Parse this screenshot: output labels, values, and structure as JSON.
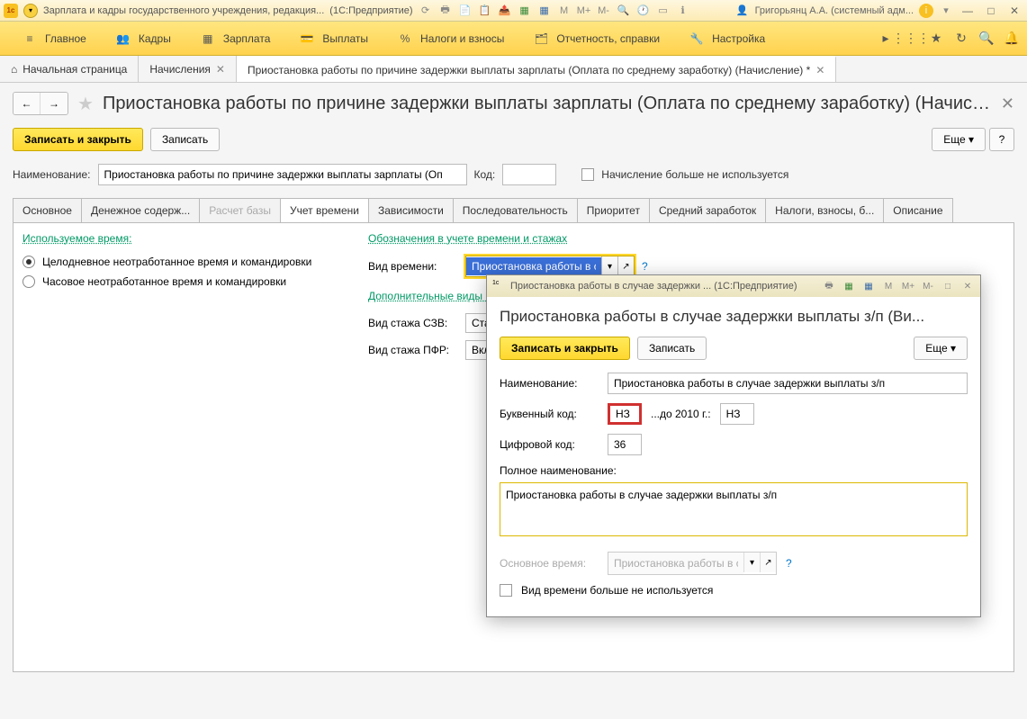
{
  "titlebar": {
    "app_title": "Зарплата и кадры государственного учреждения, редакция...",
    "platform": "(1С:Предприятие)",
    "user": "Григорьянц А.А. (системный адм...",
    "letters": [
      "M",
      "M+",
      "M-"
    ]
  },
  "menu": {
    "items": [
      {
        "label": "Главное",
        "icon": "≡"
      },
      {
        "label": "Кадры",
        "icon": "👥"
      },
      {
        "label": "Зарплата",
        "icon": "▦"
      },
      {
        "label": "Выплаты",
        "icon": "💳"
      },
      {
        "label": "Налоги и взносы",
        "icon": "%"
      },
      {
        "label": "Отчетность, справки",
        "icon": "🗂"
      },
      {
        "label": "Настройка",
        "icon": "🔧"
      }
    ]
  },
  "tabs": {
    "items": [
      {
        "label": "Начальная страница",
        "icon": "⌂",
        "closable": false
      },
      {
        "label": "Начисления",
        "closable": true
      },
      {
        "label": "Приостановка работы по причине задержки выплаты зарплаты (Оплата по среднему заработку) (Начисление) *",
        "closable": true,
        "active": true
      }
    ]
  },
  "page": {
    "title": "Приостановка работы по причине задержки выплаты зарплаты (Оплата по среднему заработку) (Начислени..."
  },
  "toolbar": {
    "save_close": "Записать и закрыть",
    "save": "Записать",
    "more": "Еще",
    "help": "?"
  },
  "form": {
    "name_label": "Наименование:",
    "name_value": "Приостановка работы по причине задержки выплаты зарплаты (Оп",
    "code_label": "Код:",
    "code_value": "",
    "not_used_label": "Начисление больше не используется"
  },
  "inner_tabs": [
    "Основное",
    "Денежное содерж...",
    "Расчет базы",
    "Учет времени",
    "Зависимости",
    "Последовательность",
    "Приоритет",
    "Средний заработок",
    "Налоги, взносы, б...",
    "Описание"
  ],
  "inner_tabs_active": 3,
  "inner_tabs_disabled": [
    2
  ],
  "time_tab": {
    "used_time_title": "Используемое время:",
    "radio1": "Целодневное неотработанное время и командировки",
    "radio2": "Часовое неотработанное время и командировки",
    "designations_title": "Обозначения в учете времени и стажах",
    "time_type_label": "Вид времени:",
    "time_type_value": "Приостановка работы в сл",
    "additional_title": "Дополнительные виды вр",
    "szv_label": "Вид стажа СЗВ:",
    "szv_value": "Стаж д",
    "pfr_label": "Вид стажа ПФР:",
    "pfr_value": "Включ"
  },
  "modal": {
    "window_title": "Приостановка работы в случае задержки ...  (1С:Предприятие)",
    "title": "Приостановка работы в случае задержки выплаты з/п (Ви...",
    "save_close": "Записать и закрыть",
    "save": "Записать",
    "more": "Еще",
    "name_label": "Наименование:",
    "name_value": "Приостановка работы в случае задержки выплаты з/п",
    "letter_code_label": "Буквенный код:",
    "letter_code_value": "НЗ",
    "until_2010_label": "...до 2010 г.:",
    "until_2010_value": "НЗ",
    "digit_code_label": "Цифровой код:",
    "digit_code_value": "36",
    "full_name_label": "Полное наименование:",
    "full_name_value": "Приостановка работы в случае задержки выплаты з/п",
    "main_time_label": "Основное время:",
    "main_time_value": "Приостановка работы в сл",
    "not_used_label": "Вид времени больше не используется",
    "letters": [
      "M",
      "M+",
      "M-"
    ]
  }
}
